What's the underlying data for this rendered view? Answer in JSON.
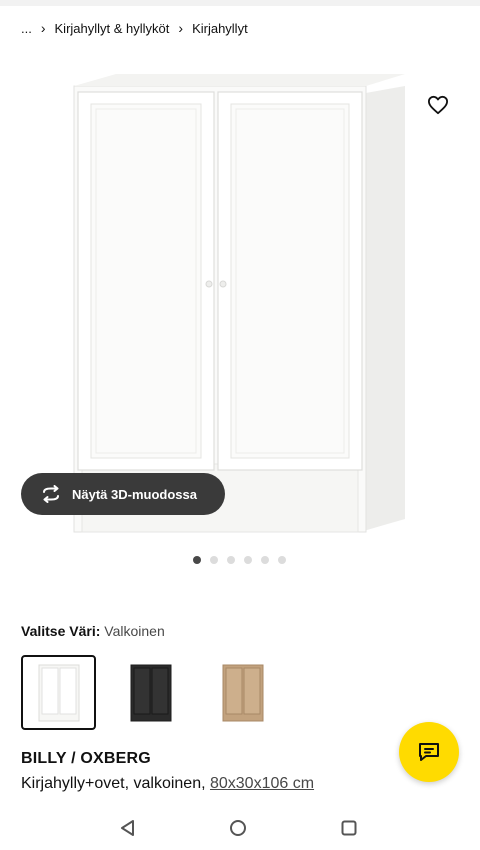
{
  "breadcrumb": {
    "ellipsis": "...",
    "items": [
      "Kirjahyllyt & hyllyköt",
      "Kirjahyllyt"
    ]
  },
  "gallery": {
    "view_3d_label": "Näytä 3D-muodossa",
    "image_count": 6,
    "active_index": 0
  },
  "color_picker": {
    "label": "Valitse Väri:",
    "selected_value": "Valkoinen",
    "options": [
      {
        "name": "white",
        "color": "#f4f4f2",
        "selected": true
      },
      {
        "name": "black-brown",
        "color": "#2b2b2b",
        "selected": false
      },
      {
        "name": "oak-effect",
        "color": "#c2a27e",
        "selected": false
      }
    ]
  },
  "product": {
    "name": "BILLY / OXBERG",
    "description": "Kirjahylly+ovet, valkoinen, ",
    "dimensions": "80x30x106 cm"
  },
  "colors": {
    "accent": "#ffdb00",
    "dark_button": "#3a3a3a"
  },
  "icons": {
    "favorite": "heart-icon",
    "view_3d": "rotate-icon",
    "chat": "chat-icon",
    "nav_back": "back-icon",
    "nav_home": "home-icon",
    "nav_recents": "recents-icon"
  }
}
